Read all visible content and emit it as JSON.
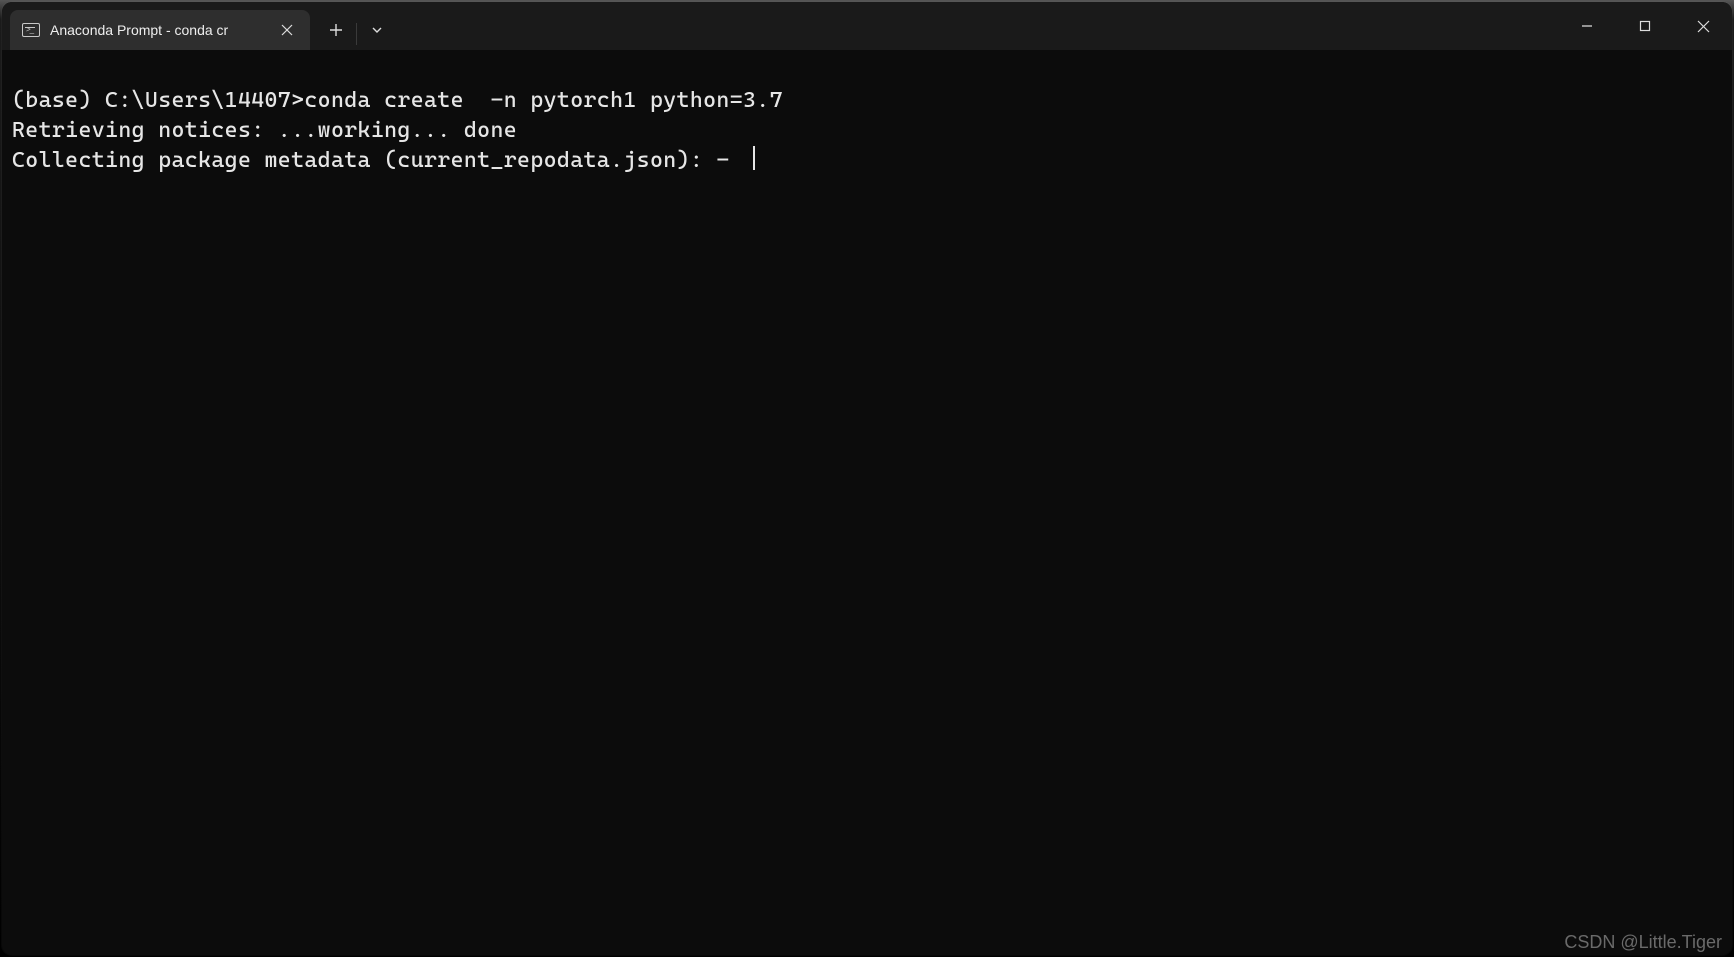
{
  "tab": {
    "title": "Anaconda Prompt - conda  cr"
  },
  "terminal": {
    "lines": [
      "(base) C:\\Users\\14407>conda create  -n pytorch1 python=3.7",
      "Retrieving notices: ...working... done",
      "Collecting package metadata (current_repodata.json): - "
    ]
  },
  "watermark": "CSDN @Little.Tiger"
}
